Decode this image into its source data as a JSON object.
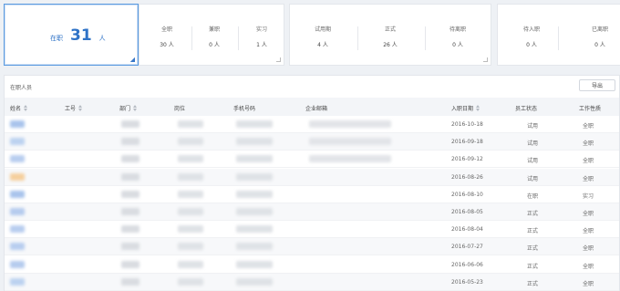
{
  "summary": {
    "on_job": {
      "label": "在职",
      "count": "31",
      "unit": "人"
    },
    "employment": [
      {
        "title": "全职",
        "value": "30 人"
      },
      {
        "title": "兼职",
        "value": "0 人"
      },
      {
        "title": "实习",
        "value": "1 人"
      }
    ],
    "status": [
      {
        "title": "试用期",
        "value": "4 人"
      },
      {
        "title": "正式",
        "value": "26 人"
      },
      {
        "title": "待离职",
        "value": "0 人"
      }
    ],
    "pipeline": [
      {
        "title": "待入职",
        "value": "0 人"
      },
      {
        "title": "已离职",
        "value": "0 人"
      }
    ]
  },
  "table": {
    "title": "在职人员",
    "export_label": "导出",
    "columns": [
      "姓名",
      "工号",
      "部门",
      "岗位",
      "手机号码",
      "企业邮箱",
      "入职日期",
      "员工状态",
      "工作性质"
    ],
    "rows": [
      {
        "date": "2016-10-18",
        "status": "试用",
        "type": "全职"
      },
      {
        "date": "2016-09-18",
        "status": "试用",
        "type": "全职"
      },
      {
        "date": "2016-09-12",
        "status": "试用",
        "type": "全职"
      },
      {
        "date": "2016-08-26",
        "status": "试用",
        "type": "全职"
      },
      {
        "date": "2016-08-10",
        "status": "在职",
        "type": "实习"
      },
      {
        "date": "2016-08-05",
        "status": "正式",
        "type": "全职"
      },
      {
        "date": "2016-08-04",
        "status": "正式",
        "type": "全职"
      },
      {
        "date": "2016-07-27",
        "status": "正式",
        "type": "全职"
      },
      {
        "date": "2016-06-06",
        "status": "正式",
        "type": "全职"
      },
      {
        "date": "2016-05-23",
        "status": "正式",
        "type": "全职"
      }
    ]
  },
  "colors": {
    "accent": "#2f73c7",
    "header_bg": "#f3f5f8",
    "page_bg": "#eef1f5"
  }
}
